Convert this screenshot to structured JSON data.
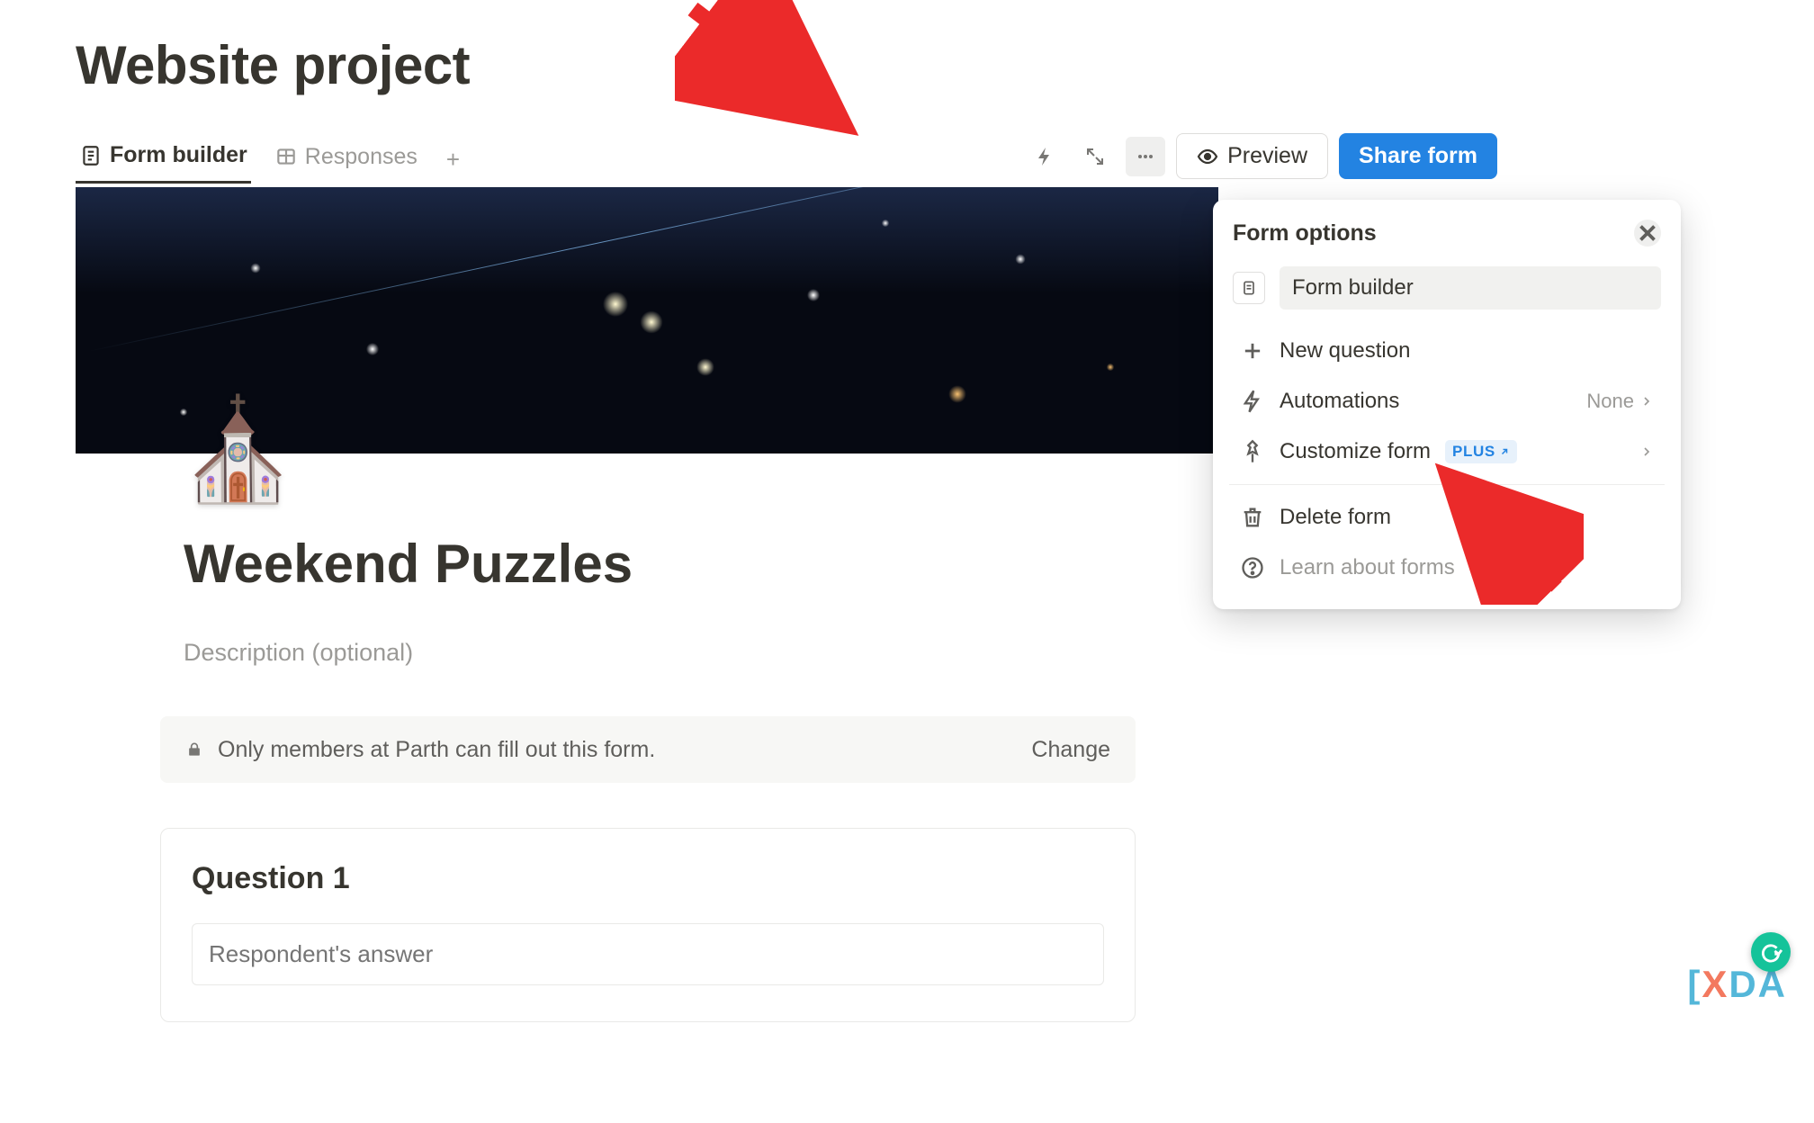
{
  "page": {
    "title": "Website project"
  },
  "tabs": {
    "form_builder": "Form builder",
    "responses": "Responses"
  },
  "toolbar": {
    "preview": "Preview",
    "share": "Share form"
  },
  "form": {
    "icon": "⛪",
    "title": "Weekend Puzzles",
    "description_placeholder": "Description (optional)"
  },
  "access": {
    "message": "Only members at Parth can fill out this form.",
    "change": "Change"
  },
  "question": {
    "title": "Question 1",
    "answer_placeholder": "Respondent's answer"
  },
  "popup": {
    "title": "Form options",
    "input_value": "Form builder",
    "new_question": "New question",
    "automations": "Automations",
    "automations_value": "None",
    "customize": "Customize form",
    "customize_badge": "PLUS",
    "delete": "Delete form",
    "learn": "Learn about forms"
  },
  "watermark": {
    "text": "XDA"
  }
}
